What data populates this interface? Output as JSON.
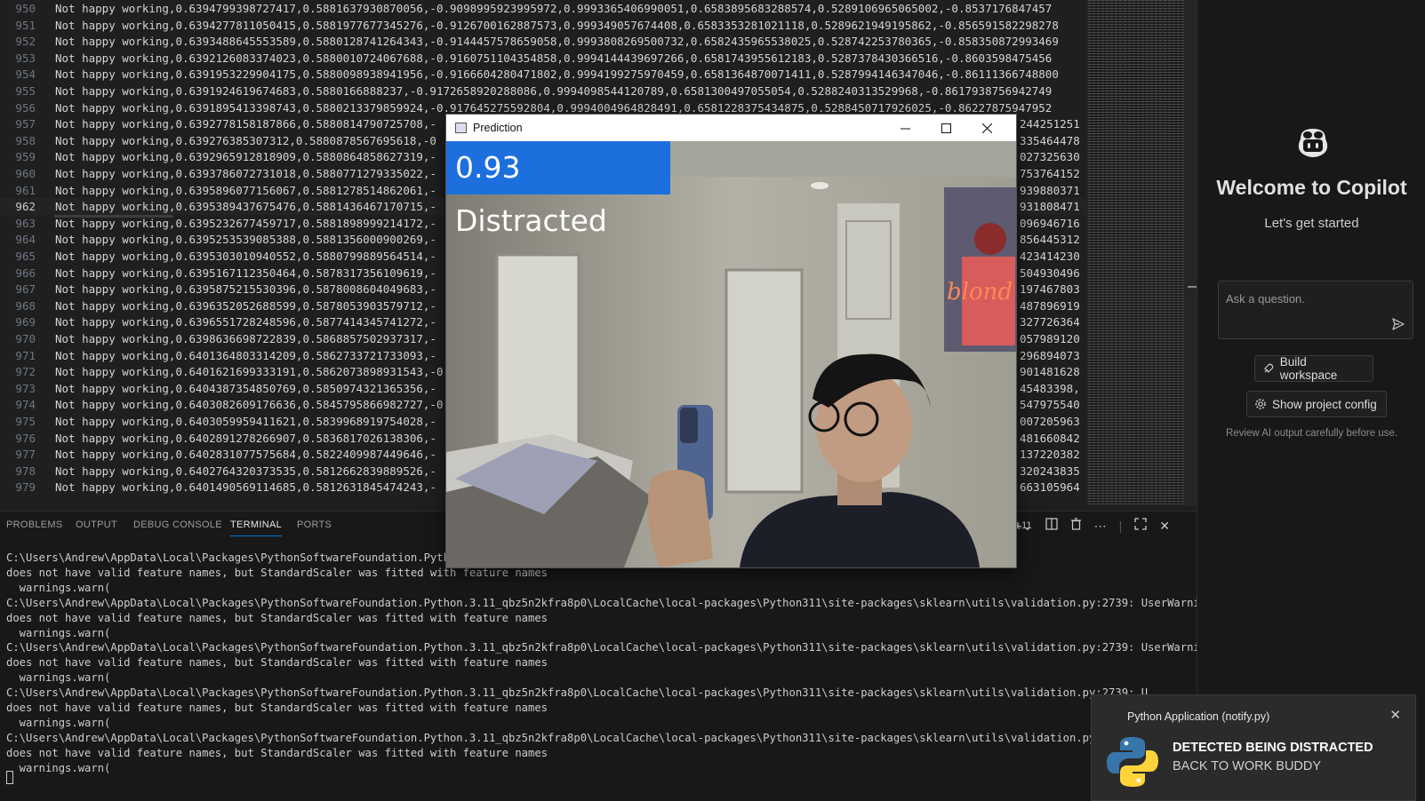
{
  "editor": {
    "current_line": 962,
    "lines": [
      {
        "n": "950",
        "text": "Not happy working,0.6394799398727417,0.5881637930870056,-0.9098995923995972,0.9993365406990051,0.6583895683288574,0.5289106965065002,-0.8537176847457"
      },
      {
        "n": "951",
        "text": "Not happy working,0.6394277811050415,0.5881977677345276,-0.9126700162887573,0.999349057674408,0.6583353281021118,0.5289621949195862,-0.856591582298278"
      },
      {
        "n": "952",
        "text": "Not happy working,0.6393488645553589,0.5880128741264343,-0.9144457578659058,0.9993808269500732,0.6582435965538025,0.528742253780365,-0.858350872993469"
      },
      {
        "n": "953",
        "text": "Not happy working,0.6392126083374023,0.5880010724067688,-0.9160751104354858,0.9994144439697266,0.6581743955612183,0.5287378430366516,-0.8603598475456"
      },
      {
        "n": "954",
        "text": "Not happy working,0.6391953229904175,0.5880098938941956,-0.9166604280471802,0.9994199275970459,0.6581364870071411,0.5287994146347046,-0.86111366748800"
      },
      {
        "n": "955",
        "text": "Not happy working,0.6391924619674683,0.5880166888237,-0.9172658920288086,0.9994098544120789,0.6581300497055054,0.5288240313529968,-0.8617938756942749"
      },
      {
        "n": "956",
        "text": "Not happy working,0.6391895413398743,0.5880213379859924,-0.917645275592804,0.9994004964828491,0.6581228375434875,0.5288450717926025,-0.86227875947952"
      },
      {
        "n": "957",
        "text": "Not happy working,0.6392778158187866,0.5880814790725708,-"
      },
      {
        "n": "958",
        "text": "Not happy working,0.639276385307312,0.5880878567695618,-0"
      },
      {
        "n": "959",
        "text": "Not happy working,0.6392965912818909,0.5880864858627319,-"
      },
      {
        "n": "960",
        "text": "Not happy working,0.6393786072731018,0.5880771279335022,-"
      },
      {
        "n": "961",
        "text": "Not happy working,0.6395896077156067,0.5881278514862061,-"
      },
      {
        "n": "962",
        "text": "Not happy working,0.6395389437675476,0.5881436467170715,-"
      },
      {
        "n": "963",
        "text": "Not happy working,0.6395232677459717,0.5881898999214172,-"
      },
      {
        "n": "964",
        "text": "Not happy working,0.6395253539085388,0.5881356000900269,-"
      },
      {
        "n": "965",
        "text": "Not happy working,0.6395303010940552,0.5880799889564514,-"
      },
      {
        "n": "966",
        "text": "Not happy working,0.6395167112350464,0.5878317356109619,-"
      },
      {
        "n": "967",
        "text": "Not happy working,0.6395875215530396,0.5878008604049683,-"
      },
      {
        "n": "968",
        "text": "Not happy working,0.6396352052688599,0.5878053903579712,-"
      },
      {
        "n": "969",
        "text": "Not happy working,0.6396551728248596,0.5877414345741272,-"
      },
      {
        "n": "970",
        "text": "Not happy working,0.6398636698722839,0.5868857502937317,-"
      },
      {
        "n": "971",
        "text": "Not happy working,0.6401364803314209,0.5862733721733093,-"
      },
      {
        "n": "972",
        "text": "Not happy working,0.6401621699333191,0.5862073898931543,-0"
      },
      {
        "n": "973",
        "text": "Not happy working,0.6404387354850769,0.5850974321365356,-"
      },
      {
        "n": "974",
        "text": "Not happy working,0.6403082609176636,0.5845795866982727,-0"
      },
      {
        "n": "975",
        "text": "Not happy working,0.6403059959411621,0.5839968919754028,-"
      },
      {
        "n": "976",
        "text": "Not happy working,0.6402891278266907,0.5836817026138306,-"
      },
      {
        "n": "977",
        "text": "Not happy working,0.6402831077575684,0.5822409987449646,-"
      },
      {
        "n": "978",
        "text": "Not happy working,0.6402764320373535,0.5812662839889526,-"
      },
      {
        "n": "979",
        "text": "Not happy working,0.6401490569114685,0.5812631845474243,-"
      }
    ],
    "right_fragments": [
      "244251251",
      "335464478",
      "027325630",
      "753764152",
      "939880371",
      "931808471",
      "096946716",
      "856445312",
      "423414230",
      "504930496",
      "197467803",
      "487896919",
      "327726364",
      "057989120",
      "296894073",
      "901481628",
      "45483398,",
      "547975540",
      "007205963",
      "481660842",
      "137220382",
      "320243835",
      "663105964"
    ]
  },
  "panel": {
    "tabs": [
      "PROBLEMS",
      "OUTPUT",
      "DEBUG CONSOLE",
      "TERMINAL",
      "PORTS"
    ],
    "active_tab": "TERMINAL",
    "python_version": "3.11",
    "terminal_lines": [
      "C:\\Users\\Andrew\\AppData\\Local\\Packages\\PythonSoftwareFoundation.Python                                                        on.py:2739: UserWarning: X",
      "does not have valid feature names, but StandardScaler was fitted with feature names",
      "  warnings.warn(",
      "C:\\Users\\Andrew\\AppData\\Local\\Packages\\PythonSoftwareFoundation.Python.3.11_qbz5n2kfra8p0\\LocalCache\\local-packages\\Python311\\site-packages\\sklearn\\utils\\validation.py:2739: UserWarning: X",
      "does not have valid feature names, but StandardScaler was fitted with feature names",
      "  warnings.warn(",
      "C:\\Users\\Andrew\\AppData\\Local\\Packages\\PythonSoftwareFoundation.Python.3.11_qbz5n2kfra8p0\\LocalCache\\local-packages\\Python311\\site-packages\\sklearn\\utils\\validation.py:2739: UserWarning: X",
      "does not have valid feature names, but StandardScaler was fitted with feature names",
      "  warnings.warn(",
      "C:\\Users\\Andrew\\AppData\\Local\\Packages\\PythonSoftwareFoundation.Python.3.11_qbz5n2kfra8p0\\LocalCache\\local-packages\\Python311\\site-packages\\sklearn\\utils\\validation.py:2739: U",
      "does not have valid feature names, but StandardScaler was fitted with feature names",
      "  warnings.warn(",
      "C:\\Users\\Andrew\\AppData\\Local\\Packages\\PythonSoftwareFoundation.Python.3.11_qbz5n2kfra8p0\\LocalCache\\local-packages\\Python311\\site-packages\\sklearn\\utils\\validation.py:2739:",
      "does not have valid feature names, but StandardScaler was fitted with feature names",
      "  warnings.warn("
    ]
  },
  "copilot": {
    "title": "Welcome to Copilot",
    "subtitle": "Let's get started",
    "ask_placeholder": "Ask a question.",
    "build_workspace": "Build workspace",
    "show_project_config": "Show project config",
    "review_note": "Review AI output carefully before use."
  },
  "prediction_window": {
    "title": "Prediction",
    "label": "0.93 Distracted",
    "label_color": "#1d6fde"
  },
  "toast": {
    "app": "Python Application (notify.py)",
    "title": "DETECTED BEING DISTRACTED",
    "body": "BACK TO WORK BUDDY"
  },
  "colors": {
    "editor_bg": "#1f1f1f",
    "panel_bg": "#181818",
    "accent": "#0078d4"
  }
}
